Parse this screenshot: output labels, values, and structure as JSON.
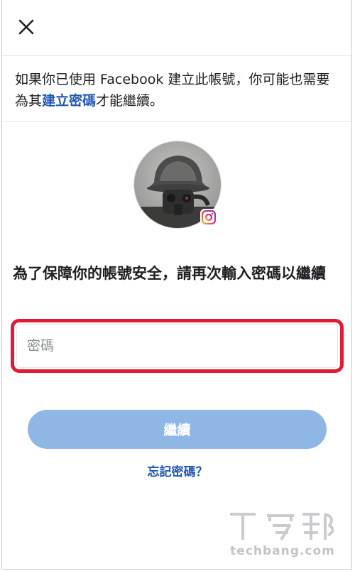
{
  "notice": {
    "text_before": "如果你已使用 Facebook 建立此帳號，你可能也需要為其",
    "link": "建立密碼",
    "text_after": "才能繼續。"
  },
  "heading": "為了保障你的帳號安全，請再次輸入密碼以繼續",
  "password": {
    "placeholder": "密碼",
    "value": ""
  },
  "continue_label": "繼續",
  "forgot_label": "忘記密碼？",
  "watermark": {
    "logo_text": "T客邦",
    "text": "techbang.com"
  },
  "colors": {
    "link": "#1f56b5",
    "button": "#8fb7e6",
    "highlight": "#e01b33"
  },
  "icons": {
    "close": "close-icon",
    "badge": "instagram-icon"
  }
}
